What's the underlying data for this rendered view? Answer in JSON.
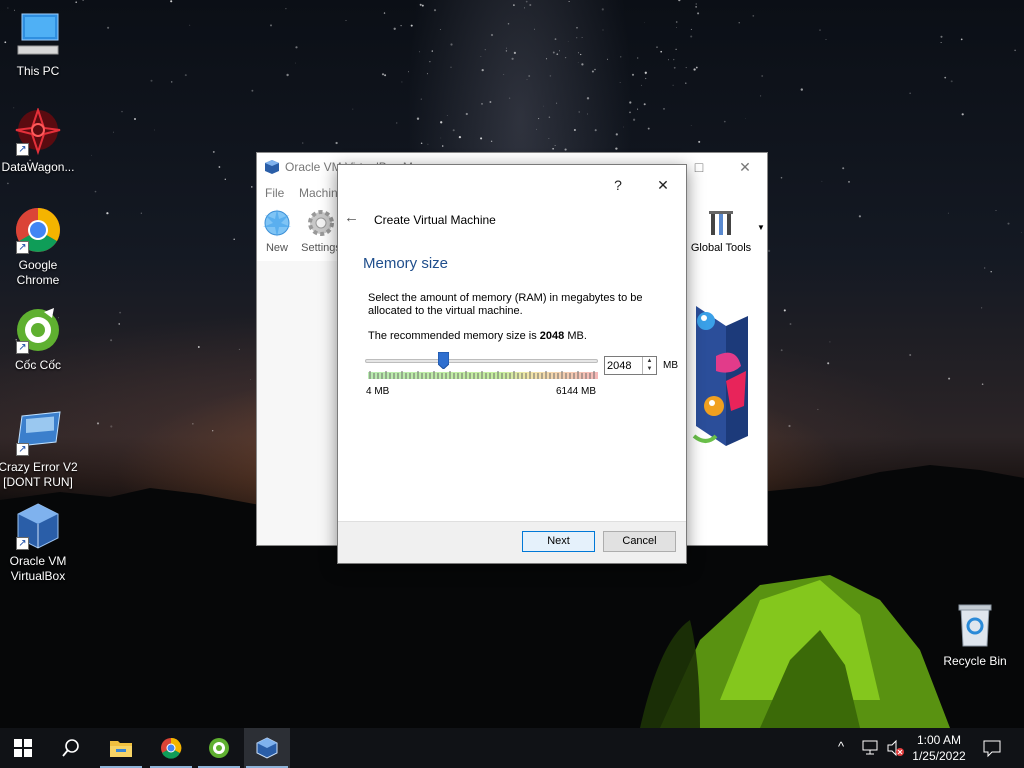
{
  "desktop": {
    "icons": [
      {
        "label_line1": "This PC",
        "label_line2": ""
      },
      {
        "label_line1": "DataWagon...",
        "label_line2": ""
      },
      {
        "label_line1": "Google",
        "label_line2": "Chrome"
      },
      {
        "label_line1": "Cốc Cốc",
        "label_line2": ""
      },
      {
        "label_line1": "Crazy Error V2",
        "label_line2": "[DONT RUN]"
      },
      {
        "label_line1": "Oracle VM",
        "label_line2": "VirtualBox"
      },
      {
        "label_line1": "Recycle Bin",
        "label_line2": ""
      }
    ]
  },
  "vbox_window": {
    "title": "Oracle VM VirtualBox Manager",
    "menu": [
      "File",
      "Machine"
    ],
    "toolbar": {
      "new_label": "New",
      "settings_label": "Settings",
      "global_tools_label": "Global Tools"
    },
    "maximize_icon": "□",
    "close_icon": "✕"
  },
  "dialog": {
    "help_label": "?",
    "close_label": "✕",
    "back_label": "←",
    "title": "Create Virtual Machine",
    "section_title": "Memory size",
    "description": "Select the amount of memory (RAM) in megabytes to be allocated to the virtual machine.",
    "recommend_prefix": "The recommended memory size is ",
    "recommend_value": "2048",
    "recommend_suffix": " MB.",
    "memory": {
      "value": "2048",
      "min": 4,
      "max": 6144,
      "min_label": "4 MB",
      "max_label": "6144 MB",
      "unit": "MB"
    },
    "next_label": "Next",
    "cancel_label": "Cancel"
  },
  "taskbar": {
    "pinned": [
      "start-icon",
      "search-icon",
      "file-explorer-icon",
      "chrome-icon",
      "coccoc-icon",
      "virtualbox-icon"
    ],
    "time": "1:00 AM",
    "date": "1/25/2022"
  }
}
